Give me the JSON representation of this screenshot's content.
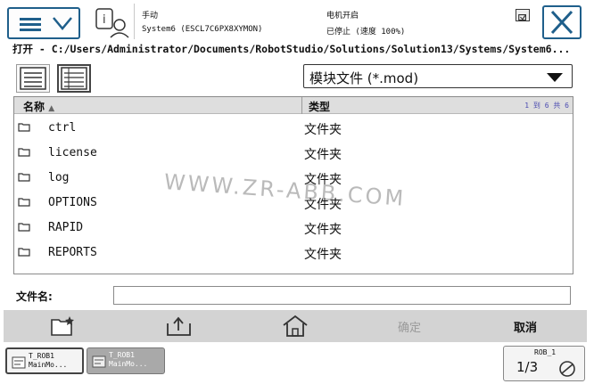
{
  "status": {
    "mode": "手动",
    "system": "System6 (ESCL7C6PX8XYMON)",
    "motor": "电机开启",
    "program_state": "已停止 (速度 100%)"
  },
  "path": "打开 - C:/Users/Administrator/Documents/RobotStudio/Solutions/Solution13/Systems/System6...",
  "filter": {
    "label": "模块文件 (*.mod)"
  },
  "list": {
    "columns": {
      "name": "名称",
      "type": "类型"
    },
    "count": "1 到 6 共 6",
    "rows": [
      {
        "name": "ctrl",
        "type": "文件夹"
      },
      {
        "name": "license",
        "type": "文件夹"
      },
      {
        "name": "log",
        "type": "文件夹"
      },
      {
        "name": "OPTIONS",
        "type": "文件夹"
      },
      {
        "name": "RAPID",
        "type": "文件夹"
      },
      {
        "name": "REPORTS",
        "type": "文件夹"
      }
    ]
  },
  "filename": {
    "label": "文件名:",
    "value": ""
  },
  "commands": {
    "confirm": "确定",
    "cancel": "取消"
  },
  "taskbar": {
    "tasks": [
      {
        "line1": "T_ROB1",
        "line2": "MainMo..."
      },
      {
        "line1": "T_ROB1",
        "line2": "MainMo..."
      }
    ],
    "quickset_label": "ROB_1",
    "quickset_fraction": "1/3"
  },
  "watermark": "WWW.ZR-ABB.COM",
  "colors": {
    "accent": "#1f5f8b",
    "command_bar": "#d3d3d3",
    "header_bg": "#dedede",
    "disabled_text": "#9a9a9a"
  },
  "icons": {
    "menu": "hamburger-menu-icon",
    "log": "event-log-icon",
    "close": "close-icon",
    "folder": "folder-icon",
    "new_folder": "new-folder-icon",
    "up": "up-folder-icon",
    "home": "home-icon"
  }
}
